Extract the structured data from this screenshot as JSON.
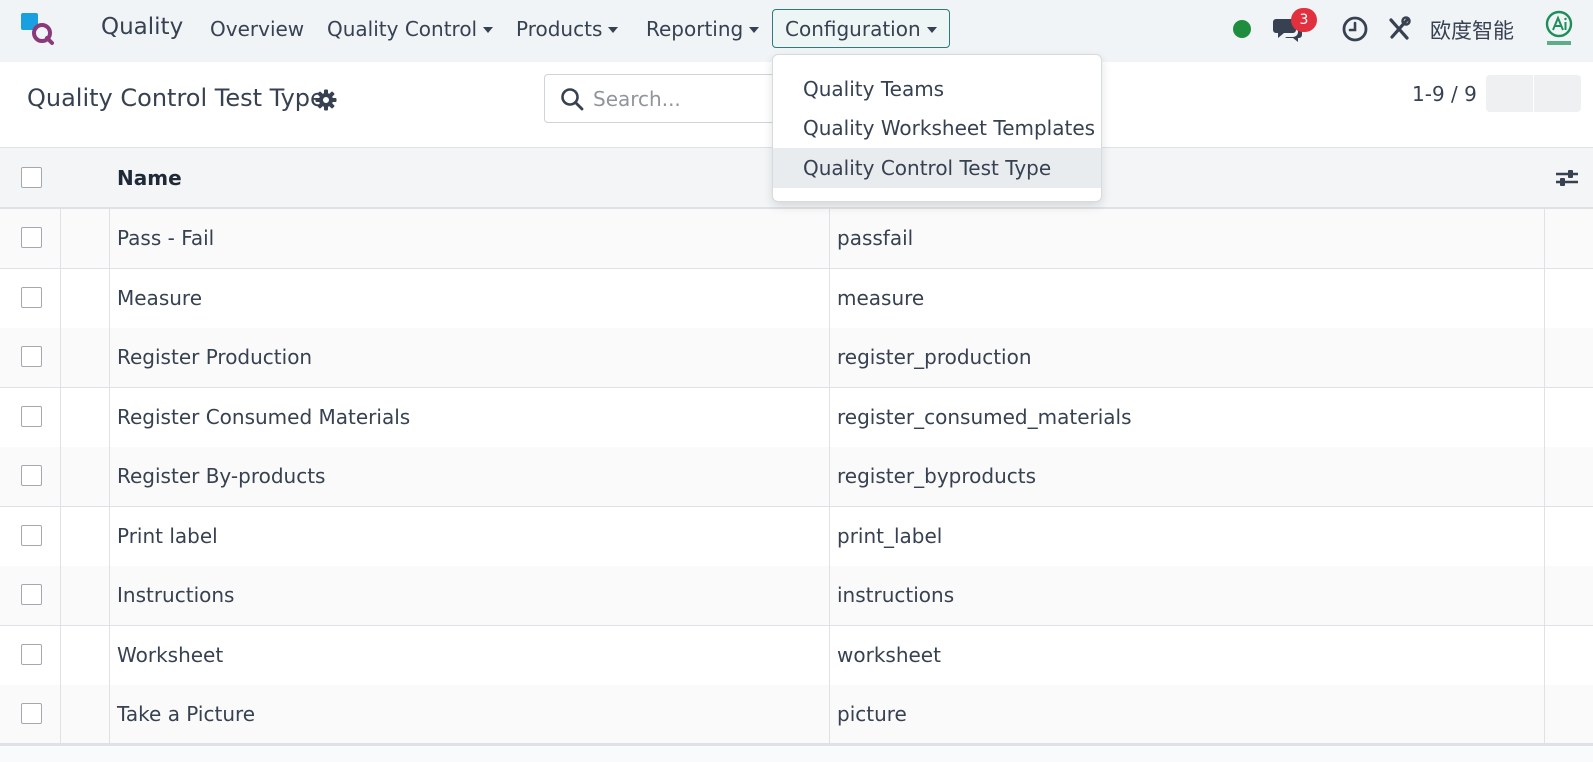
{
  "navbar": {
    "app_name": "Quality",
    "menus": [
      {
        "label": "Overview",
        "has_caret": false
      },
      {
        "label": "Quality Control",
        "has_caret": true
      },
      {
        "label": "Products",
        "has_caret": true
      },
      {
        "label": "Reporting",
        "has_caret": true
      },
      {
        "label": "Configuration",
        "has_caret": true
      }
    ],
    "notification_count": "3",
    "company_name": "欧度智能",
    "status_color": "#1e8e3e",
    "badge_color": "#e2313e"
  },
  "control_panel": {
    "title": "Quality Control Test Type",
    "search_placeholder": "Search...",
    "pager_value": "1-9 / 9"
  },
  "list": {
    "header_name": "Name",
    "rows": [
      {
        "name": "Pass - Fail",
        "technical_name": "passfail"
      },
      {
        "name": "Measure",
        "technical_name": "measure"
      },
      {
        "name": "Register Production",
        "technical_name": "register_production"
      },
      {
        "name": "Register Consumed Materials",
        "technical_name": "register_consumed_materials"
      },
      {
        "name": "Register By-products",
        "technical_name": "register_byproducts"
      },
      {
        "name": "Print label",
        "technical_name": "print_label"
      },
      {
        "name": "Instructions",
        "technical_name": "instructions"
      },
      {
        "name": "Worksheet",
        "technical_name": "worksheet"
      },
      {
        "name": "Take a Picture",
        "technical_name": "picture"
      }
    ]
  },
  "configuration_dropdown": {
    "items": [
      {
        "label": "Quality Teams",
        "active": false
      },
      {
        "label": "Quality Worksheet Templates",
        "active": false
      },
      {
        "label": "Quality Control Test Type",
        "active": true
      }
    ]
  }
}
